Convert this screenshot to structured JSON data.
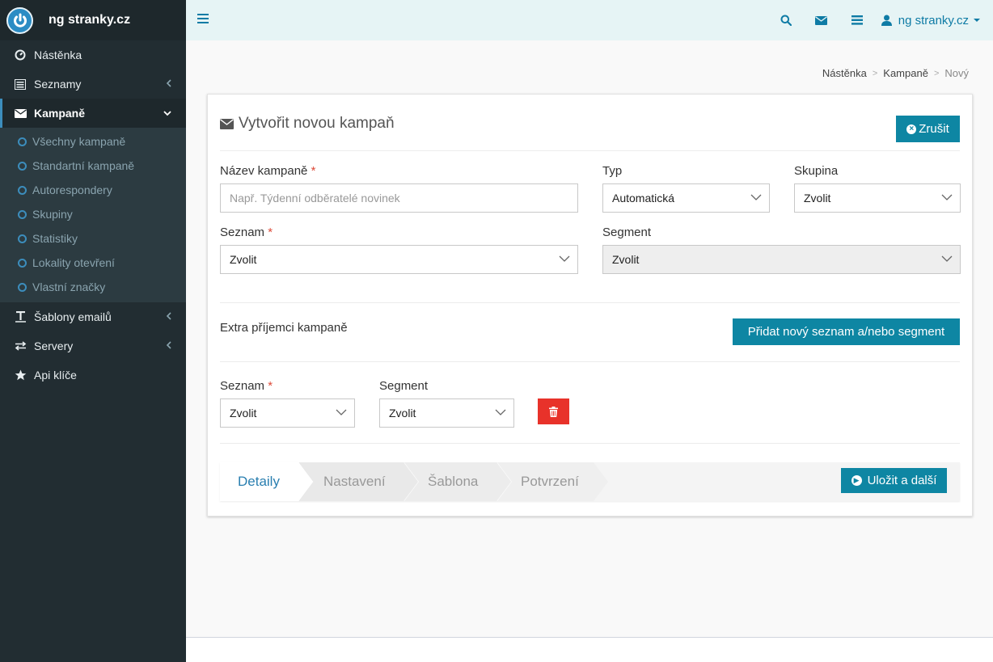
{
  "brand": {
    "name": "ng stranky.cz",
    "logo_icon": "power-icon"
  },
  "sidebar": {
    "items": [
      {
        "label": "Nástěnka",
        "icon": "dashboard-icon"
      },
      {
        "label": "Seznamy",
        "icon": "list-icon"
      },
      {
        "label": "Kampaně",
        "icon": "envelope-icon"
      },
      {
        "label": "Šablony emailů",
        "icon": "text-icon"
      },
      {
        "label": "Servery",
        "icon": "exchange-icon"
      },
      {
        "label": "Api klíče",
        "icon": "star-icon"
      }
    ],
    "subitems": [
      "Všechny kampaně",
      "Standartní kampaně",
      "Autorespondery",
      "Skupiny",
      "Statistiky",
      "Lokality otevření",
      "Vlastní značky"
    ]
  },
  "topbar": {
    "user": "ng stranky.cz",
    "icons": [
      "search-icon",
      "envelope-icon",
      "list-icon",
      "user-icon"
    ]
  },
  "breadcrumb": {
    "items": [
      "Nástěnka",
      "Kampaně",
      "Nový"
    ],
    "separator": ">"
  },
  "card": {
    "title": "Vytvořit novou kampaň",
    "cancel_label": "Zrušit",
    "name_label": "Název kampaně",
    "required_mark": "*",
    "name_placeholder": "Např. Týdenní odběratelé novinek",
    "type_label": "Typ",
    "type_value": "Automatická",
    "group_label": "Skupina",
    "group_value": "Zvolit",
    "list_label": "Seznam",
    "list_value": "Zvolit",
    "segment_label": "Segment",
    "segment_value": "Zvolit",
    "extra_label": "Extra příjemci kampaně",
    "add_label": "Přidat nový seznam a/nebo segment",
    "extra_list_label": "Seznam",
    "extra_list_value": "Zvolit",
    "extra_segment_label": "Segment",
    "extra_segment_value": "Zvolit"
  },
  "wizard": {
    "steps": [
      "Detaily",
      "Nastavení",
      "Šablona",
      "Potvrzení"
    ],
    "active_step": 0,
    "save_label": "Uložit a další"
  },
  "colors": {
    "accent": "#0e86a3",
    "danger": "#e8322a",
    "sidebar": "#222d32",
    "topbar": "#e6f4f5",
    "link": "#2a7fb0"
  }
}
